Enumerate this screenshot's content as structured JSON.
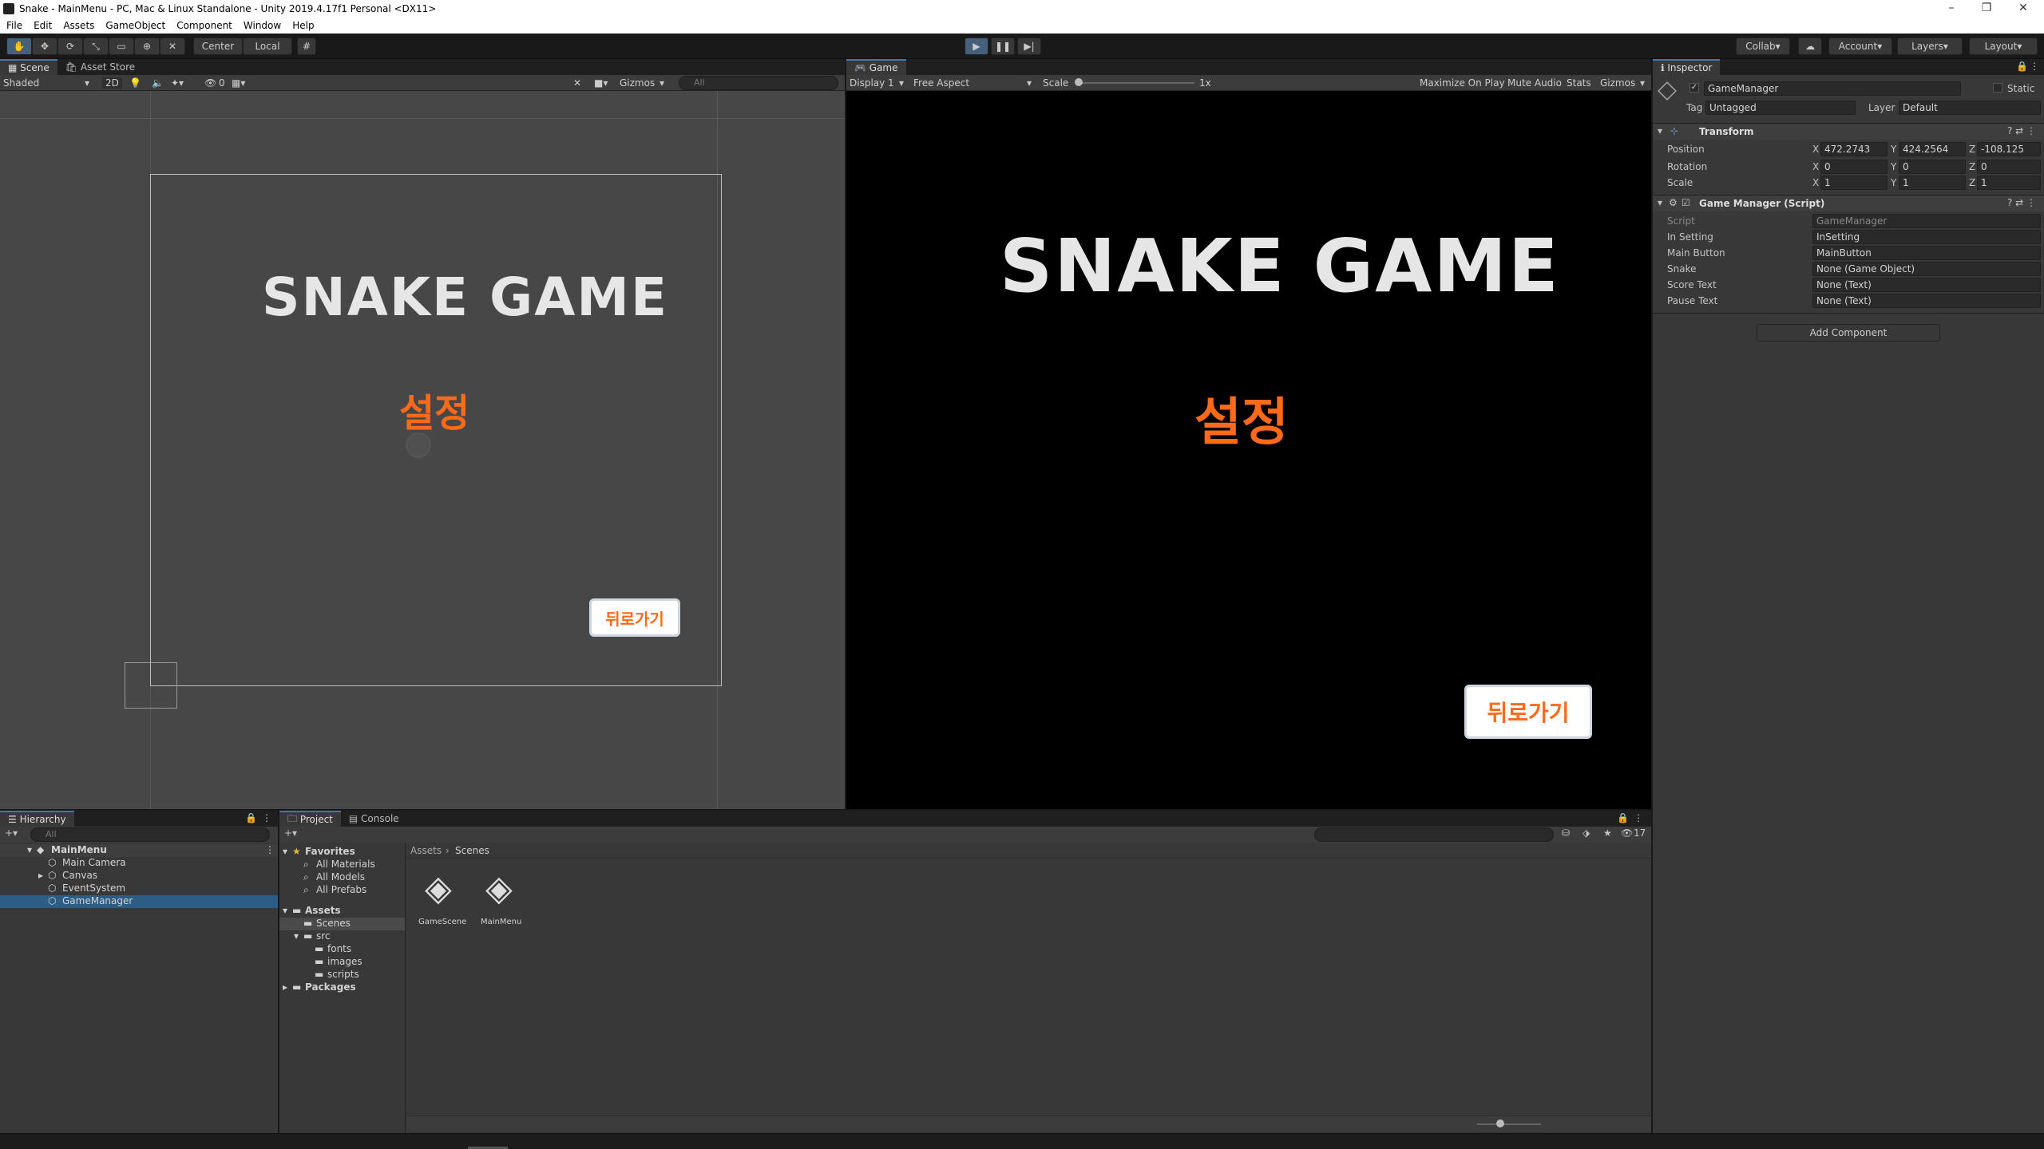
{
  "window": {
    "title": "Snake - MainMenu - PC, Mac & Linux Standalone - Unity 2019.4.17f1 Personal <DX11>"
  },
  "menu": [
    "File",
    "Edit",
    "Assets",
    "GameObject",
    "Component",
    "Window",
    "Help"
  ],
  "toolbar": {
    "pivot": "Center",
    "space": "Local",
    "collab": "Collab",
    "account": "Account",
    "layers": "Layers",
    "layout": "Layout",
    "play_state": "playing"
  },
  "scene": {
    "tabs": [
      "Scene",
      "Asset Store"
    ],
    "shading": "Shaded",
    "mode2d": "2D",
    "hidden_count": "0",
    "gizmos": "Gizmos",
    "search_placeholder": "All",
    "title": "SNAKE GAME",
    "subtitle": "설정",
    "back": "뒤로가기"
  },
  "game": {
    "tab": "Game",
    "display": "Display 1",
    "aspect": "Free Aspect",
    "scale_label": "Scale",
    "scale_value": "1x",
    "maximize": "Maximize On Play",
    "mute": "Mute Audio",
    "stats": "Stats",
    "gizmos": "Gizmos",
    "title": "SNAKE GAME",
    "subtitle": "설정",
    "back": "뒤로가기"
  },
  "inspector": {
    "tab": "Inspector",
    "object_name": "GameManager",
    "static": "Static",
    "tag_label": "Tag",
    "tag": "Untagged",
    "layer_label": "Layer",
    "layer": "Default",
    "transform": {
      "title": "Transform",
      "position_label": "Position",
      "rotation_label": "Rotation",
      "scale_label": "Scale",
      "position": {
        "x": "472.2743",
        "y": "424.2564",
        "z": "-108.125"
      },
      "rotation": {
        "x": "0",
        "y": "0",
        "z": "0"
      },
      "scale": {
        "x": "1",
        "y": "1",
        "z": "1"
      }
    },
    "script": {
      "title": "Game Manager (Script)",
      "rows": [
        {
          "label": "Script",
          "value": "GameManager"
        },
        {
          "label": "In Setting",
          "value": "InSetting"
        },
        {
          "label": "Main Button",
          "value": "MainButton"
        },
        {
          "label": "Snake",
          "value": "None (Game Object)"
        },
        {
          "label": "Score Text",
          "value": "None (Text)"
        },
        {
          "label": "Pause Text",
          "value": "None (Text)"
        }
      ]
    },
    "add_component": "Add Component"
  },
  "hierarchy": {
    "tab": "Hierarchy",
    "search_placeholder": "All",
    "scene": "MainMenu",
    "items": [
      "Main Camera",
      "Canvas",
      "EventSystem",
      "GameManager"
    ]
  },
  "project": {
    "tabs": [
      "Project",
      "Console"
    ],
    "favorites": "Favorites",
    "favorite_items": [
      "All Materials",
      "All Models",
      "All Prefabs"
    ],
    "assets": "Assets",
    "folders": [
      "Scenes",
      "src",
      "fonts",
      "images",
      "scripts"
    ],
    "packages": "Packages",
    "breadcrumb": [
      "Assets",
      "Scenes"
    ],
    "files": [
      "GameScene",
      "MainMenu"
    ],
    "hidden_count": "17"
  }
}
